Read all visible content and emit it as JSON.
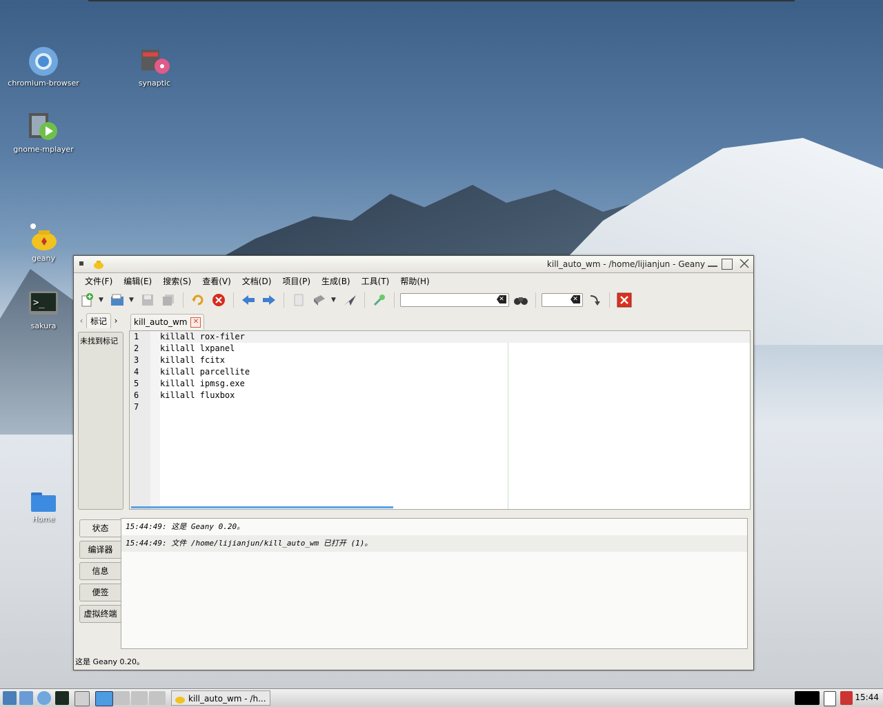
{
  "desktop": {
    "icons": [
      {
        "label": "chromium-browser",
        "icon": "chromium-icon"
      },
      {
        "label": "synaptic",
        "icon": "synaptic-icon"
      },
      {
        "label": "gnome-mplayer",
        "icon": "mplayer-icon"
      },
      {
        "label": "geany",
        "icon": "geany-icon"
      },
      {
        "label": "sakura",
        "icon": "terminal-icon"
      },
      {
        "label": "Home",
        "icon": "folder-icon"
      }
    ]
  },
  "window": {
    "title": "kill_auto_wm - /home/lijianjun - Geany",
    "menu": [
      "文件(F)",
      "编辑(E)",
      "搜索(S)",
      "查看(V)",
      "文档(D)",
      "项目(P)",
      "生成(B)",
      "工具(T)",
      "帮助(H)"
    ],
    "search_value": "",
    "goto_value": ""
  },
  "sidebar": {
    "tab_label": "标记",
    "empty_text": "未找到标记"
  },
  "document": {
    "tab_label": "kill_auto_wm",
    "line_numbers": [
      "1",
      "2",
      "3",
      "4",
      "5",
      "6",
      "7"
    ],
    "lines": [
      "killall rox-filer",
      "killall lxpanel",
      "killall fcitx",
      "killall parcellite",
      "killall ipmsg.exe",
      "killall fluxbox",
      ""
    ]
  },
  "messages": {
    "tabs": [
      "状态",
      "编译器",
      "信息",
      "便签",
      "虚拟终端"
    ],
    "lines": [
      "15:44:49: 这是 Geany 0.20。",
      "15:44:49: 文件 /home/lijianjun/kill_auto_wm 已打开 (1)。"
    ]
  },
  "statusbar": {
    "text": "这是 Geany 0.20。"
  },
  "taskbar": {
    "task_label": "kill_auto_wm - /h...",
    "clock": "15:44"
  },
  "colors": {
    "accent_blue": "#5aa3e6",
    "close_red": "#d8402a"
  }
}
